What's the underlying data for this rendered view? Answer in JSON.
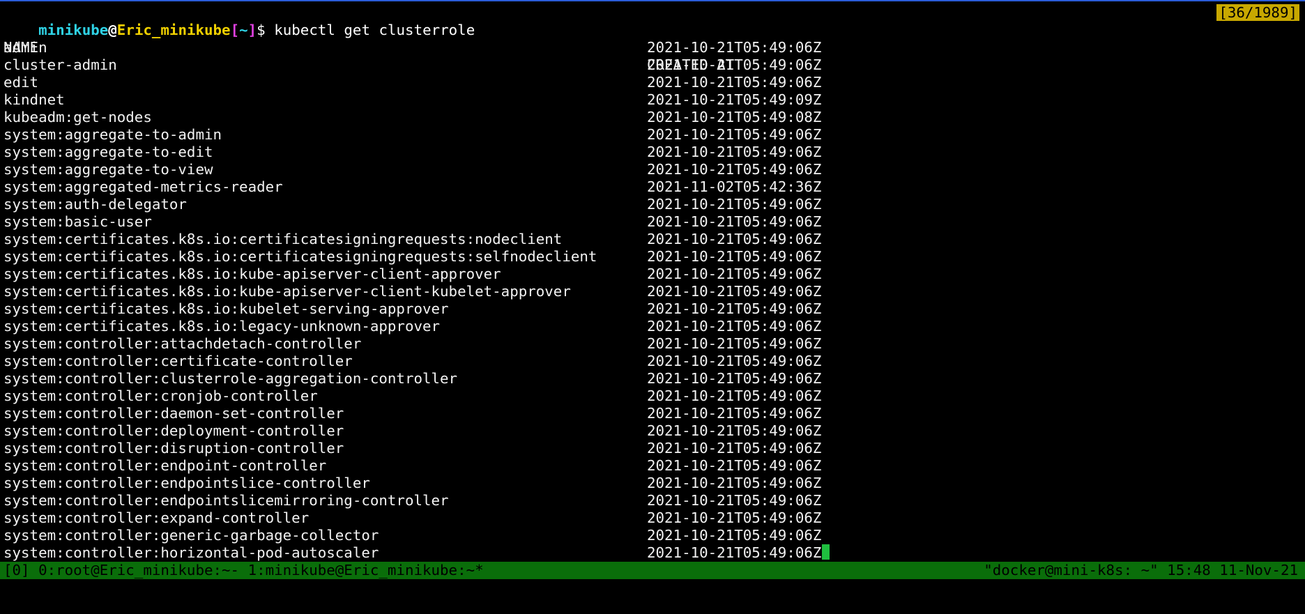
{
  "prompt": {
    "user": "minikube",
    "at": "@",
    "host": "Eric_minikube",
    "bracket_open": "[",
    "dir": "~",
    "bracket_close": "]",
    "sign": "$",
    "command": "kubectl get clusterrole"
  },
  "counter": "[36/1989]",
  "headers": {
    "name": "NAME",
    "created": "CREATED AT"
  },
  "rows": [
    {
      "name": "admin",
      "created": "2021-10-21T05:49:06Z"
    },
    {
      "name": "cluster-admin",
      "created": "2021-10-21T05:49:06Z"
    },
    {
      "name": "edit",
      "created": "2021-10-21T05:49:06Z"
    },
    {
      "name": "kindnet",
      "created": "2021-10-21T05:49:09Z"
    },
    {
      "name": "kubeadm:get-nodes",
      "created": "2021-10-21T05:49:08Z"
    },
    {
      "name": "system:aggregate-to-admin",
      "created": "2021-10-21T05:49:06Z"
    },
    {
      "name": "system:aggregate-to-edit",
      "created": "2021-10-21T05:49:06Z"
    },
    {
      "name": "system:aggregate-to-view",
      "created": "2021-10-21T05:49:06Z"
    },
    {
      "name": "system:aggregated-metrics-reader",
      "created": "2021-11-02T05:42:36Z"
    },
    {
      "name": "system:auth-delegator",
      "created": "2021-10-21T05:49:06Z"
    },
    {
      "name": "system:basic-user",
      "created": "2021-10-21T05:49:06Z"
    },
    {
      "name": "system:certificates.k8s.io:certificatesigningrequests:nodeclient",
      "created": "2021-10-21T05:49:06Z"
    },
    {
      "name": "system:certificates.k8s.io:certificatesigningrequests:selfnodeclient",
      "created": "2021-10-21T05:49:06Z"
    },
    {
      "name": "system:certificates.k8s.io:kube-apiserver-client-approver",
      "created": "2021-10-21T05:49:06Z"
    },
    {
      "name": "system:certificates.k8s.io:kube-apiserver-client-kubelet-approver",
      "created": "2021-10-21T05:49:06Z"
    },
    {
      "name": "system:certificates.k8s.io:kubelet-serving-approver",
      "created": "2021-10-21T05:49:06Z"
    },
    {
      "name": "system:certificates.k8s.io:legacy-unknown-approver",
      "created": "2021-10-21T05:49:06Z"
    },
    {
      "name": "system:controller:attachdetach-controller",
      "created": "2021-10-21T05:49:06Z"
    },
    {
      "name": "system:controller:certificate-controller",
      "created": "2021-10-21T05:49:06Z"
    },
    {
      "name": "system:controller:clusterrole-aggregation-controller",
      "created": "2021-10-21T05:49:06Z"
    },
    {
      "name": "system:controller:cronjob-controller",
      "created": "2021-10-21T05:49:06Z"
    },
    {
      "name": "system:controller:daemon-set-controller",
      "created": "2021-10-21T05:49:06Z"
    },
    {
      "name": "system:controller:deployment-controller",
      "created": "2021-10-21T05:49:06Z"
    },
    {
      "name": "system:controller:disruption-controller",
      "created": "2021-10-21T05:49:06Z"
    },
    {
      "name": "system:controller:endpoint-controller",
      "created": "2021-10-21T05:49:06Z"
    },
    {
      "name": "system:controller:endpointslice-controller",
      "created": "2021-10-21T05:49:06Z"
    },
    {
      "name": "system:controller:endpointslicemirroring-controller",
      "created": "2021-10-21T05:49:06Z"
    },
    {
      "name": "system:controller:expand-controller",
      "created": "2021-10-21T05:49:06Z"
    },
    {
      "name": "system:controller:generic-garbage-collector",
      "created": "2021-10-21T05:49:06Z"
    },
    {
      "name": "system:controller:horizontal-pod-autoscaler",
      "created": "2021-10-21T05:49:06Z"
    }
  ],
  "statusbar": {
    "left": "[0] 0:root@Eric_minikube:~- 1:minikube@Eric_minikube:~*",
    "right": "\"docker@mini-k8s: ~\" 15:48 11-Nov-21"
  },
  "colors": {
    "background": "#000000",
    "statusbar": "#0a6e0a",
    "counter": "#c8a800",
    "cursor": "#1fbf3f",
    "prompt_user": "#2fd3e6",
    "prompt_host": "#f0d000",
    "prompt_bracket": "#e040e0"
  }
}
